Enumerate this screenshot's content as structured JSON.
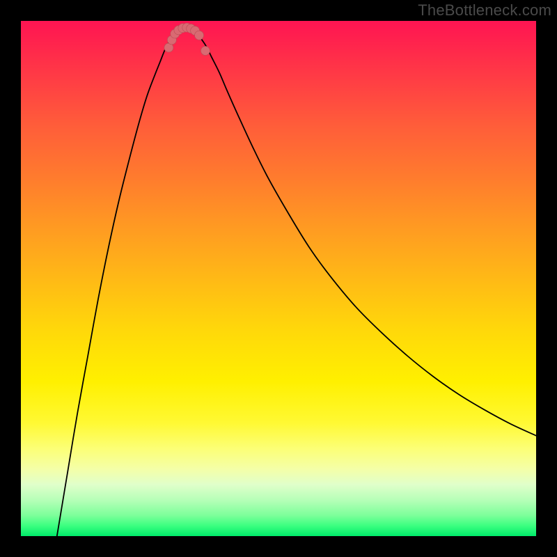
{
  "watermark": "TheBottleneck.com",
  "chart_data": {
    "type": "line",
    "title": "",
    "xlabel": "",
    "ylabel": "",
    "x_range_pct": [
      0,
      100
    ],
    "y_range_pct": [
      0,
      100
    ],
    "curve_points_pct": [
      [
        7.0,
        0.0
      ],
      [
        9.0,
        12.0
      ],
      [
        11.0,
        24.0
      ],
      [
        13.0,
        35.0
      ],
      [
        15.0,
        46.0
      ],
      [
        17.0,
        56.0
      ],
      [
        19.0,
        65.0
      ],
      [
        21.0,
        73.0
      ],
      [
        23.0,
        80.5
      ],
      [
        24.5,
        85.5
      ],
      [
        26.0,
        89.5
      ],
      [
        27.0,
        92.0
      ],
      [
        28.0,
        94.5
      ],
      [
        29.0,
        96.3
      ],
      [
        30.0,
        97.5
      ],
      [
        31.0,
        98.3
      ],
      [
        31.7,
        98.5
      ],
      [
        32.5,
        98.5
      ],
      [
        33.3,
        98.3
      ],
      [
        34.0,
        97.7
      ],
      [
        35.0,
        96.5
      ],
      [
        36.0,
        95.0
      ],
      [
        37.0,
        93.0
      ],
      [
        38.5,
        90.0
      ],
      [
        40.0,
        86.5
      ],
      [
        42.0,
        82.0
      ],
      [
        45.0,
        75.5
      ],
      [
        48.0,
        69.5
      ],
      [
        52.0,
        62.5
      ],
      [
        56.0,
        56.0
      ],
      [
        60.0,
        50.5
      ],
      [
        65.0,
        44.5
      ],
      [
        70.0,
        39.5
      ],
      [
        75.0,
        35.0
      ],
      [
        80.0,
        31.0
      ],
      [
        85.0,
        27.5
      ],
      [
        90.0,
        24.5
      ],
      [
        95.0,
        21.8
      ],
      [
        100.0,
        19.5
      ]
    ],
    "highlight_dots_pct": [
      [
        28.7,
        94.8
      ],
      [
        29.3,
        96.3
      ],
      [
        29.9,
        97.5
      ],
      [
        30.6,
        98.2
      ],
      [
        31.4,
        98.6
      ],
      [
        32.2,
        98.7
      ],
      [
        33.0,
        98.5
      ],
      [
        33.8,
        98.1
      ],
      [
        34.6,
        97.2
      ],
      [
        35.8,
        94.2
      ]
    ]
  },
  "colors": {
    "dot_fill": "#d96a72",
    "curve_stroke": "#000000"
  }
}
